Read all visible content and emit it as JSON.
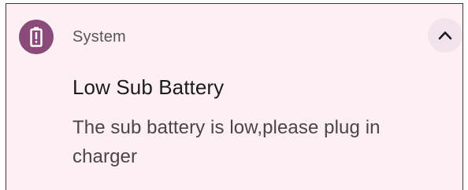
{
  "notification": {
    "app_name": "System",
    "app_icon": "battery-alert-icon",
    "title": "Low Sub Battery",
    "body": "The sub battery is low,please plug in charger",
    "collapse_icon": "chevron-up-icon"
  },
  "colors": {
    "icon_background": "#8a4b7a",
    "card_background": "#fdf0f4",
    "collapse_button_background": "#f1e4ea"
  }
}
